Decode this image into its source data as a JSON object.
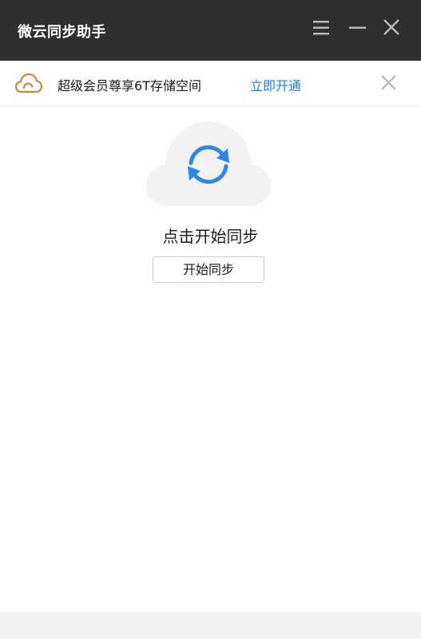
{
  "app": {
    "title": "微云同步助手"
  },
  "titlebar": {
    "menu_icon": "menu-icon",
    "minimize_icon": "minimize-icon",
    "close_icon": "close-icon"
  },
  "banner": {
    "icon": "cloud-icon",
    "text": "超级会员尊享6T存储空间",
    "link": "立即开通",
    "dismiss_icon": "close-icon"
  },
  "main": {
    "hero_icon": "sync-icon",
    "status": "点击开始同步",
    "start_button": "开始同步"
  },
  "colors": {
    "titlebar_bg": "#2f2f2f",
    "accent_blue": "#1f7fe0",
    "sync_blue": "#2f86e6",
    "cloud_orange": "#c8893e",
    "hero_cloud_bg": "#f2f2f2"
  }
}
